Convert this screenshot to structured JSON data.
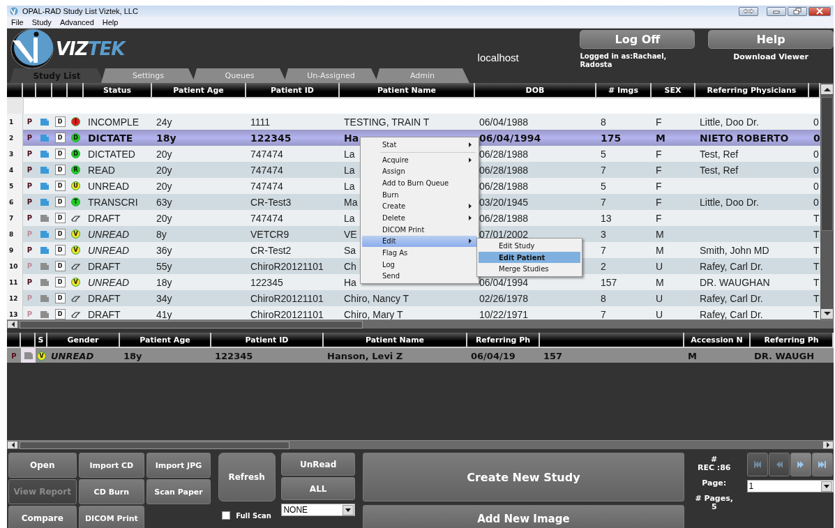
{
  "window": {
    "title": "OPAL-RAD Study List Viztek, LLC"
  },
  "menu_bar": [
    "File",
    "Study",
    "Advanced",
    "Help"
  ],
  "header": {
    "logo": [
      "VIZ",
      "TEK"
    ],
    "server": "localhost",
    "log_off": "Log Off",
    "logged_in": "Logged in as:Rachael, Radosta",
    "help": "Help",
    "download": "Download Viewer"
  },
  "tabs": [
    {
      "label": "Study List",
      "selected": true
    },
    {
      "label": "Settings",
      "selected": false
    },
    {
      "label": "Queues",
      "selected": false
    },
    {
      "label": "Un-Assigned",
      "selected": false
    },
    {
      "label": "Admin",
      "selected": false
    }
  ],
  "study_table": {
    "columns": [
      "Status",
      "Patient Age",
      "Patient ID",
      "Patient Name",
      "DOB",
      "# Imgs",
      "SEX",
      "Referring Physicians"
    ],
    "rows": [
      {
        "num": "1",
        "p": "P",
        "p_dim": false,
        "viewed": true,
        "d": "D",
        "dot": {
          "kind": "letter",
          "letter": "I",
          "color": "#e81c1c"
        },
        "status": "INCOMPLE",
        "italic": false,
        "age": "24y",
        "patient_id": "1111",
        "name": "TESTING, TRAIN T",
        "dob": "06/04/1988",
        "imgs": "8",
        "sex": "F",
        "ref": "Little, Doo Dr.",
        "col_14": "0",
        "selected": false
      },
      {
        "num": "2",
        "p": "P",
        "p_dim": false,
        "viewed": true,
        "d": "D",
        "dot": {
          "kind": "letter",
          "letter": "D",
          "color": "#22cc22"
        },
        "status": "DICTATE",
        "italic": false,
        "age": "18y",
        "patient_id": "122345",
        "name": "Ha",
        "dob": "06/04/1994",
        "imgs": "175",
        "sex": "M",
        "ref": "NIETO ROBERTO",
        "col_14": "0",
        "selected": true
      },
      {
        "num": "3",
        "p": "P",
        "p_dim": false,
        "viewed": true,
        "d": "D",
        "dot": {
          "kind": "letter",
          "letter": "D",
          "color": "#22cc22"
        },
        "status": "DICTATED",
        "italic": false,
        "age": "20y",
        "patient_id": "747474",
        "name": "La",
        "dob": "06/28/1988",
        "imgs": "5",
        "sex": "F",
        "ref": "Test, Ref",
        "col_14": "0",
        "selected": false
      },
      {
        "num": "4",
        "p": "P",
        "p_dim": false,
        "viewed": true,
        "d": "D",
        "dot": {
          "kind": "letter",
          "letter": "R",
          "color": "#22cc22"
        },
        "status": "READ",
        "italic": false,
        "age": "20y",
        "patient_id": "747474",
        "name": "La",
        "dob": "06/28/1988",
        "imgs": "7",
        "sex": "F",
        "ref": "Test, Ref",
        "col_14": "0",
        "selected": false
      },
      {
        "num": "5",
        "p": "P",
        "p_dim": false,
        "viewed": true,
        "d": "D",
        "dot": {
          "kind": "letter",
          "letter": "U",
          "color": "#f0e020"
        },
        "status": "UNREAD",
        "italic": false,
        "age": "20y",
        "patient_id": "747474",
        "name": "La",
        "dob": "06/28/1988",
        "imgs": "5",
        "sex": "F",
        "col_14": "0",
        "selected": false
      },
      {
        "num": "6",
        "p": "P",
        "p_dim": false,
        "viewed": true,
        "d": "D",
        "dot": {
          "kind": "letter",
          "letter": "T",
          "color": "#22cc22"
        },
        "status": "TRANSCRI",
        "italic": false,
        "age": "63y",
        "patient_id": "CR-Test3",
        "name": "Ma",
        "dob": "03/20/1945",
        "imgs": "7",
        "sex": "F",
        "ref": "Little, Doo Dr.",
        "col_14": "0",
        "selected": false
      },
      {
        "num": "7",
        "p": "P",
        "p_dim": false,
        "viewed": false,
        "d": "D",
        "dot": {
          "kind": "draft"
        },
        "status": "DRAFT",
        "italic": false,
        "age": "20y",
        "patient_id": "747474",
        "name": "La",
        "dob": "06/28/1988",
        "imgs": "13",
        "sex": "F",
        "col_14": "T",
        "selected": false
      },
      {
        "num": "8",
        "p": "P",
        "p_dim": true,
        "viewed": true,
        "d": "D",
        "dot": {
          "kind": "letter",
          "letter": "V",
          "color": "#f0e020"
        },
        "status": "UNREAD",
        "italic": true,
        "age": "8y",
        "patient_id": "VETCR9",
        "name": "VE",
        "dob": "07/01/2002",
        "imgs": "3",
        "sex": "M",
        "col_14": "T",
        "selected": false
      },
      {
        "num": "9",
        "p": "P",
        "p_dim": false,
        "viewed": true,
        "d": "D",
        "dot": {
          "kind": "letter",
          "letter": "V",
          "color": "#f0e020"
        },
        "status": "UNREAD",
        "italic": true,
        "age": "36y",
        "patient_id": "CR-Test2",
        "name": "Sa",
        "imgs": "7",
        "sex": "M",
        "ref": "Smith, John MD",
        "col_14": "T",
        "selected": false
      },
      {
        "num": "10",
        "p": "P",
        "p_dim": true,
        "viewed": false,
        "d": "D",
        "dot": {
          "kind": "draft"
        },
        "status": "DRAFT",
        "italic": false,
        "age": "55y",
        "patient_id": "ChiroR20121101",
        "name": "Ch",
        "imgs": "2",
        "sex": "U",
        "ref": "Rafey, Carl Dr.",
        "col_14": "T",
        "selected": false
      },
      {
        "num": "11",
        "p": "P",
        "p_dim": false,
        "viewed": false,
        "d": "D",
        "dot": {
          "kind": "letter",
          "letter": "V",
          "color": "#f0e020"
        },
        "status": "UNREAD",
        "italic": true,
        "age": "18y",
        "patient_id": "122345",
        "name": "Ha",
        "dob": "06/04/1994",
        "imgs": "157",
        "sex": "M",
        "ref": "DR. WAUGHAN",
        "col_14": "T",
        "selected": false
      },
      {
        "num": "12",
        "p": "P",
        "p_dim": true,
        "viewed": false,
        "d": "D",
        "dot": {
          "kind": "draft"
        },
        "status": "DRAFT",
        "italic": false,
        "age": "34y",
        "patient_id": "ChiroR20121101",
        "name": "Chiro, Nancy T",
        "dob": "02/26/1978",
        "imgs": "8",
        "sex": "U",
        "ref": "Rafey, Carl Dr.",
        "col_14": "T",
        "selected": false
      },
      {
        "num": "13",
        "p": "P",
        "p_dim": true,
        "viewed": false,
        "d": "D",
        "dot": {
          "kind": "draft"
        },
        "status": "DRAFT",
        "italic": false,
        "age": "41y",
        "patient_id": "ChiroR20121101",
        "name": "Chiro, Mary T",
        "dob": "10/22/1971",
        "imgs": "7",
        "sex": "U",
        "ref": "Rafey, Carl Dr.",
        "col_14": "T",
        "selected": false
      }
    ]
  },
  "context_menu": {
    "items": [
      {
        "label": "Stat",
        "submenu": true,
        "separator_after": true,
        "selected": false
      },
      {
        "label": "Acquire",
        "submenu": true,
        "selected": false
      },
      {
        "label": "Assign",
        "submenu": false,
        "selected": false
      },
      {
        "label": "Add to Burn Queue",
        "submenu": false,
        "selected": false
      },
      {
        "label": "Burn",
        "submenu": false,
        "selected": false
      },
      {
        "label": "Create",
        "submenu": true,
        "selected": false
      },
      {
        "label": "Delete",
        "submenu": true,
        "selected": false
      },
      {
        "label": "DICOM Print",
        "submenu": false,
        "selected": false
      },
      {
        "label": "Edit",
        "submenu": true,
        "selected": true
      },
      {
        "label": "Flag As",
        "submenu": false,
        "selected": false
      },
      {
        "label": "Log",
        "submenu": false,
        "selected": false
      },
      {
        "label": "Send",
        "submenu": false,
        "selected": false
      }
    ],
    "submenu": [
      {
        "label": "Edit Study",
        "selected": false
      },
      {
        "label": "Edit Patient",
        "selected": true
      },
      {
        "label": "Merge Studies",
        "selected": false
      }
    ]
  },
  "detail_table": {
    "columns": [
      "S",
      "Gender",
      "Patient Age",
      "Patient ID",
      "Patient Name",
      "Referring Ph",
      "Accession N",
      "Referring Ph"
    ],
    "row": {
      "p": "P",
      "viewed": false,
      "dot": {
        "kind": "letter",
        "letter": "V",
        "color": "#f0e020"
      },
      "status_italic": true,
      "cells": [
        "UNREAD",
        "18y",
        "122345",
        "Hanson, Levi Z",
        "06/04/19",
        "157",
        "M",
        "DR. WAUGH"
      ]
    }
  },
  "buttons": {
    "col1": [
      {
        "label": "Open",
        "disabled": false
      },
      {
        "label": "View Report",
        "disabled": true
      },
      {
        "label": "Compare",
        "disabled": false
      }
    ],
    "col2": [
      {
        "label": "Import CD",
        "disabled": false
      },
      {
        "label": "CD Burn",
        "disabled": false
      },
      {
        "label": "DICOM Print",
        "disabled": false
      }
    ],
    "col3": [
      {
        "label": "Import JPG",
        "disabled": false
      },
      {
        "label": "Scan Paper",
        "disabled": false
      }
    ],
    "refresh": "Refresh",
    "full_scan": {
      "label": "Full Scan",
      "checked": false
    },
    "unread": "UnRead",
    "all": "ALL",
    "filter": {
      "value": "NONE"
    },
    "create": "Create New Study",
    "add_image": "Add New Image"
  },
  "pager": {
    "records": "#\nREC :86",
    "page_label": "Page:",
    "pages": "# Pages,\n5",
    "page": {
      "value": "1"
    },
    "buttons": [
      {
        "kind": "first",
        "disabled": true
      },
      {
        "kind": "prev",
        "disabled": true
      },
      {
        "kind": "next",
        "disabled": false
      },
      {
        "kind": "last",
        "disabled": false
      }
    ]
  }
}
